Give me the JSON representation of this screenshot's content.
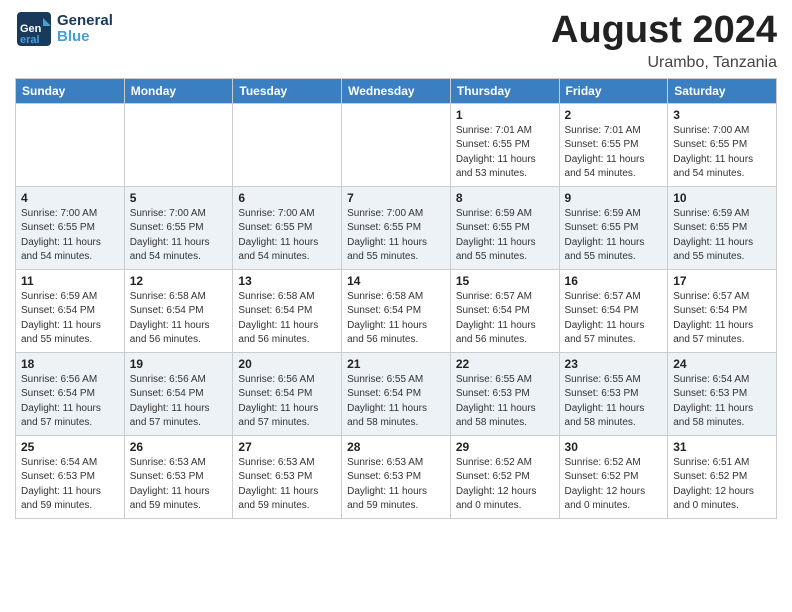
{
  "header": {
    "logo_line1": "General",
    "logo_line2": "Blue",
    "month": "August 2024",
    "location": "Urambo, Tanzania"
  },
  "weekdays": [
    "Sunday",
    "Monday",
    "Tuesday",
    "Wednesday",
    "Thursday",
    "Friday",
    "Saturday"
  ],
  "weeks": [
    [
      {
        "day": "",
        "info": ""
      },
      {
        "day": "",
        "info": ""
      },
      {
        "day": "",
        "info": ""
      },
      {
        "day": "",
        "info": ""
      },
      {
        "day": "1",
        "info": "Sunrise: 7:01 AM\nSunset: 6:55 PM\nDaylight: 11 hours\nand 53 minutes."
      },
      {
        "day": "2",
        "info": "Sunrise: 7:01 AM\nSunset: 6:55 PM\nDaylight: 11 hours\nand 54 minutes."
      },
      {
        "day": "3",
        "info": "Sunrise: 7:00 AM\nSunset: 6:55 PM\nDaylight: 11 hours\nand 54 minutes."
      }
    ],
    [
      {
        "day": "4",
        "info": "Sunrise: 7:00 AM\nSunset: 6:55 PM\nDaylight: 11 hours\nand 54 minutes."
      },
      {
        "day": "5",
        "info": "Sunrise: 7:00 AM\nSunset: 6:55 PM\nDaylight: 11 hours\nand 54 minutes."
      },
      {
        "day": "6",
        "info": "Sunrise: 7:00 AM\nSunset: 6:55 PM\nDaylight: 11 hours\nand 54 minutes."
      },
      {
        "day": "7",
        "info": "Sunrise: 7:00 AM\nSunset: 6:55 PM\nDaylight: 11 hours\nand 55 minutes."
      },
      {
        "day": "8",
        "info": "Sunrise: 6:59 AM\nSunset: 6:55 PM\nDaylight: 11 hours\nand 55 minutes."
      },
      {
        "day": "9",
        "info": "Sunrise: 6:59 AM\nSunset: 6:55 PM\nDaylight: 11 hours\nand 55 minutes."
      },
      {
        "day": "10",
        "info": "Sunrise: 6:59 AM\nSunset: 6:55 PM\nDaylight: 11 hours\nand 55 minutes."
      }
    ],
    [
      {
        "day": "11",
        "info": "Sunrise: 6:59 AM\nSunset: 6:54 PM\nDaylight: 11 hours\nand 55 minutes."
      },
      {
        "day": "12",
        "info": "Sunrise: 6:58 AM\nSunset: 6:54 PM\nDaylight: 11 hours\nand 56 minutes."
      },
      {
        "day": "13",
        "info": "Sunrise: 6:58 AM\nSunset: 6:54 PM\nDaylight: 11 hours\nand 56 minutes."
      },
      {
        "day": "14",
        "info": "Sunrise: 6:58 AM\nSunset: 6:54 PM\nDaylight: 11 hours\nand 56 minutes."
      },
      {
        "day": "15",
        "info": "Sunrise: 6:57 AM\nSunset: 6:54 PM\nDaylight: 11 hours\nand 56 minutes."
      },
      {
        "day": "16",
        "info": "Sunrise: 6:57 AM\nSunset: 6:54 PM\nDaylight: 11 hours\nand 57 minutes."
      },
      {
        "day": "17",
        "info": "Sunrise: 6:57 AM\nSunset: 6:54 PM\nDaylight: 11 hours\nand 57 minutes."
      }
    ],
    [
      {
        "day": "18",
        "info": "Sunrise: 6:56 AM\nSunset: 6:54 PM\nDaylight: 11 hours\nand 57 minutes."
      },
      {
        "day": "19",
        "info": "Sunrise: 6:56 AM\nSunset: 6:54 PM\nDaylight: 11 hours\nand 57 minutes."
      },
      {
        "day": "20",
        "info": "Sunrise: 6:56 AM\nSunset: 6:54 PM\nDaylight: 11 hours\nand 57 minutes."
      },
      {
        "day": "21",
        "info": "Sunrise: 6:55 AM\nSunset: 6:54 PM\nDaylight: 11 hours\nand 58 minutes."
      },
      {
        "day": "22",
        "info": "Sunrise: 6:55 AM\nSunset: 6:53 PM\nDaylight: 11 hours\nand 58 minutes."
      },
      {
        "day": "23",
        "info": "Sunrise: 6:55 AM\nSunset: 6:53 PM\nDaylight: 11 hours\nand 58 minutes."
      },
      {
        "day": "24",
        "info": "Sunrise: 6:54 AM\nSunset: 6:53 PM\nDaylight: 11 hours\nand 58 minutes."
      }
    ],
    [
      {
        "day": "25",
        "info": "Sunrise: 6:54 AM\nSunset: 6:53 PM\nDaylight: 11 hours\nand 59 minutes."
      },
      {
        "day": "26",
        "info": "Sunrise: 6:53 AM\nSunset: 6:53 PM\nDaylight: 11 hours\nand 59 minutes."
      },
      {
        "day": "27",
        "info": "Sunrise: 6:53 AM\nSunset: 6:53 PM\nDaylight: 11 hours\nand 59 minutes."
      },
      {
        "day": "28",
        "info": "Sunrise: 6:53 AM\nSunset: 6:53 PM\nDaylight: 11 hours\nand 59 minutes."
      },
      {
        "day": "29",
        "info": "Sunrise: 6:52 AM\nSunset: 6:52 PM\nDaylight: 12 hours\nand 0 minutes."
      },
      {
        "day": "30",
        "info": "Sunrise: 6:52 AM\nSunset: 6:52 PM\nDaylight: 12 hours\nand 0 minutes."
      },
      {
        "day": "31",
        "info": "Sunrise: 6:51 AM\nSunset: 6:52 PM\nDaylight: 12 hours\nand 0 minutes."
      }
    ]
  ]
}
